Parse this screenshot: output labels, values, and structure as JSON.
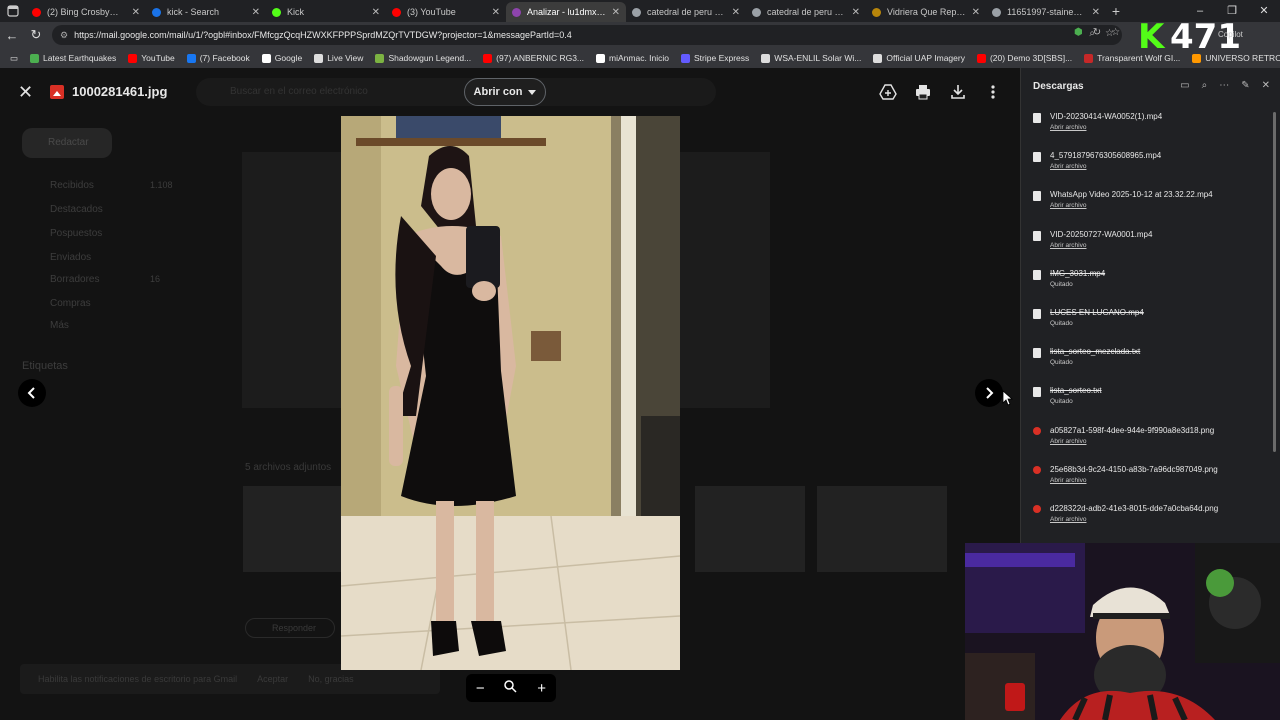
{
  "browser": {
    "tabs": [
      {
        "label": "(2) Bing Crosby💖 Best",
        "favicon_color": "#ff0000",
        "active": false
      },
      {
        "label": "kick - Search",
        "favicon_color": "#1a73e8",
        "active": false
      },
      {
        "label": "Kick",
        "favicon_color": "#53fc18",
        "active": false
      },
      {
        "label": "(3) YouTube",
        "favicon_color": "#ff0000",
        "active": false
      },
      {
        "label": "Analizar - lu1dmx.arg©",
        "favicon_color": "#8e44ad",
        "active": true
      },
      {
        "label": "catedral de peru vitrale",
        "favicon_color": "#9aa0a6",
        "active": false
      },
      {
        "label": "catedral de peru vitrale",
        "favicon_color": "#9aa0a6",
        "active": false
      },
      {
        "label": "Vidriera Que Represent",
        "favicon_color": "#b8860b",
        "active": false
      },
      {
        "label": "11651997-stained-glas",
        "favicon_color": "#9aa0a6",
        "active": false
      }
    ],
    "url": "https://mail.google.com/mail/u/1/?ogbl#inbox/FMfcgzQcqHZWXKFPPPSprdMZQrTVTDGW?projector=1&messagePartId=0.4",
    "bookmarks": [
      {
        "label": "Latest Earthquakes",
        "color": "#4caf50"
      },
      {
        "label": "YouTube",
        "color": "#ff0000"
      },
      {
        "label": "(7) Facebook",
        "color": "#1877f2"
      },
      {
        "label": "Google",
        "color": "#ffffff"
      },
      {
        "label": "Live View",
        "color": "#dddddd"
      },
      {
        "label": "Shadowgun Legend...",
        "color": "#7cb342"
      },
      {
        "label": "(97) ANBERNIC RG3...",
        "color": "#ff0000"
      },
      {
        "label": "miAnmac. Inicio",
        "color": "#ffffff"
      },
      {
        "label": "Stripe Express",
        "color": "#635bff"
      },
      {
        "label": "WSA-ENLIL Solar Wi...",
        "color": "#dddddd"
      },
      {
        "label": "Official UAP Imagery",
        "color": "#dddddd"
      },
      {
        "label": "(20) Demo 3D[SBS]...",
        "color": "#ff0000"
      },
      {
        "label": "Transparent Wolf GI...",
        "color": "#c62828"
      },
      {
        "label": "UNIVERSO RETRO...",
        "color": "#ff9800"
      }
    ],
    "window_controls": [
      "–",
      "❐",
      "✕"
    ],
    "overlay": {
      "kick": "K",
      "number": "471",
      "copilot": "Copilot"
    }
  },
  "gmail_bg": {
    "compose": "Redactar",
    "search_placeholder": "Buscar en el correo electrónico",
    "nav": [
      {
        "label": "Recibidos",
        "count": "1.108"
      },
      {
        "label": "Destacados",
        "count": ""
      },
      {
        "label": "Pospuestos",
        "count": ""
      },
      {
        "label": "Enviados",
        "count": ""
      },
      {
        "label": "Borradores",
        "count": "16"
      },
      {
        "label": "Compras",
        "count": ""
      },
      {
        "label": "Más",
        "count": ""
      }
    ],
    "labels_heading": "Etiquetas",
    "attachments_title": "5 archivos adjuntos",
    "reply": "Responder",
    "toast": {
      "text": "Habilita las notificaciones de escritorio para Gmail",
      "accept": "Aceptar",
      "dismiss": "No, gracias"
    }
  },
  "viewer": {
    "filename": "1000281461.jpg",
    "open_with": "Abrir con",
    "actions": [
      "add-to-drive-icon",
      "print-icon",
      "download-icon",
      "more-vert-icon"
    ],
    "zoom": {
      "minus": "−",
      "plus": "+"
    }
  },
  "downloads": {
    "title": "Descargas",
    "items": [
      {
        "name": "VID-20230414-WA0052(1).mp4",
        "status": "Abrir archivo",
        "removed": false,
        "kind": "file"
      },
      {
        "name": "4_5791879676305608965.mp4",
        "status": "Abrir archivo",
        "removed": false,
        "kind": "file"
      },
      {
        "name": "WhatsApp Video 2025-10-12 at 23.32.22.mp4",
        "status": "Abrir archivo",
        "removed": false,
        "kind": "file"
      },
      {
        "name": "VID-20250727-WA0001.mp4",
        "status": "Abrir archivo",
        "removed": false,
        "kind": "file"
      },
      {
        "name": "IMG_3031.mp4",
        "status": "Quitado",
        "removed": true,
        "kind": "file"
      },
      {
        "name": "LUCES EN LUGANO.mp4",
        "status": "Quitado",
        "removed": true,
        "kind": "file"
      },
      {
        "name": "lista_sorteo_mezclada.txt",
        "status": "Quitado",
        "removed": true,
        "kind": "doc"
      },
      {
        "name": "lista_sorteo.txt",
        "status": "Quitado",
        "removed": true,
        "kind": "doc"
      },
      {
        "name": "a05827a1-598f-4dee-944e-9f990a8e3d18.png",
        "status": "Abrir archivo",
        "removed": false,
        "kind": "img"
      },
      {
        "name": "25e68b3d-9c24-4150-a83b-7a96dc987049.png",
        "status": "Abrir archivo",
        "removed": false,
        "kind": "img"
      },
      {
        "name": "d228322d-adb2-41e3-8015-dde7a0cba64d.png",
        "status": "Abrir archivo",
        "removed": false,
        "kind": "img"
      }
    ]
  }
}
